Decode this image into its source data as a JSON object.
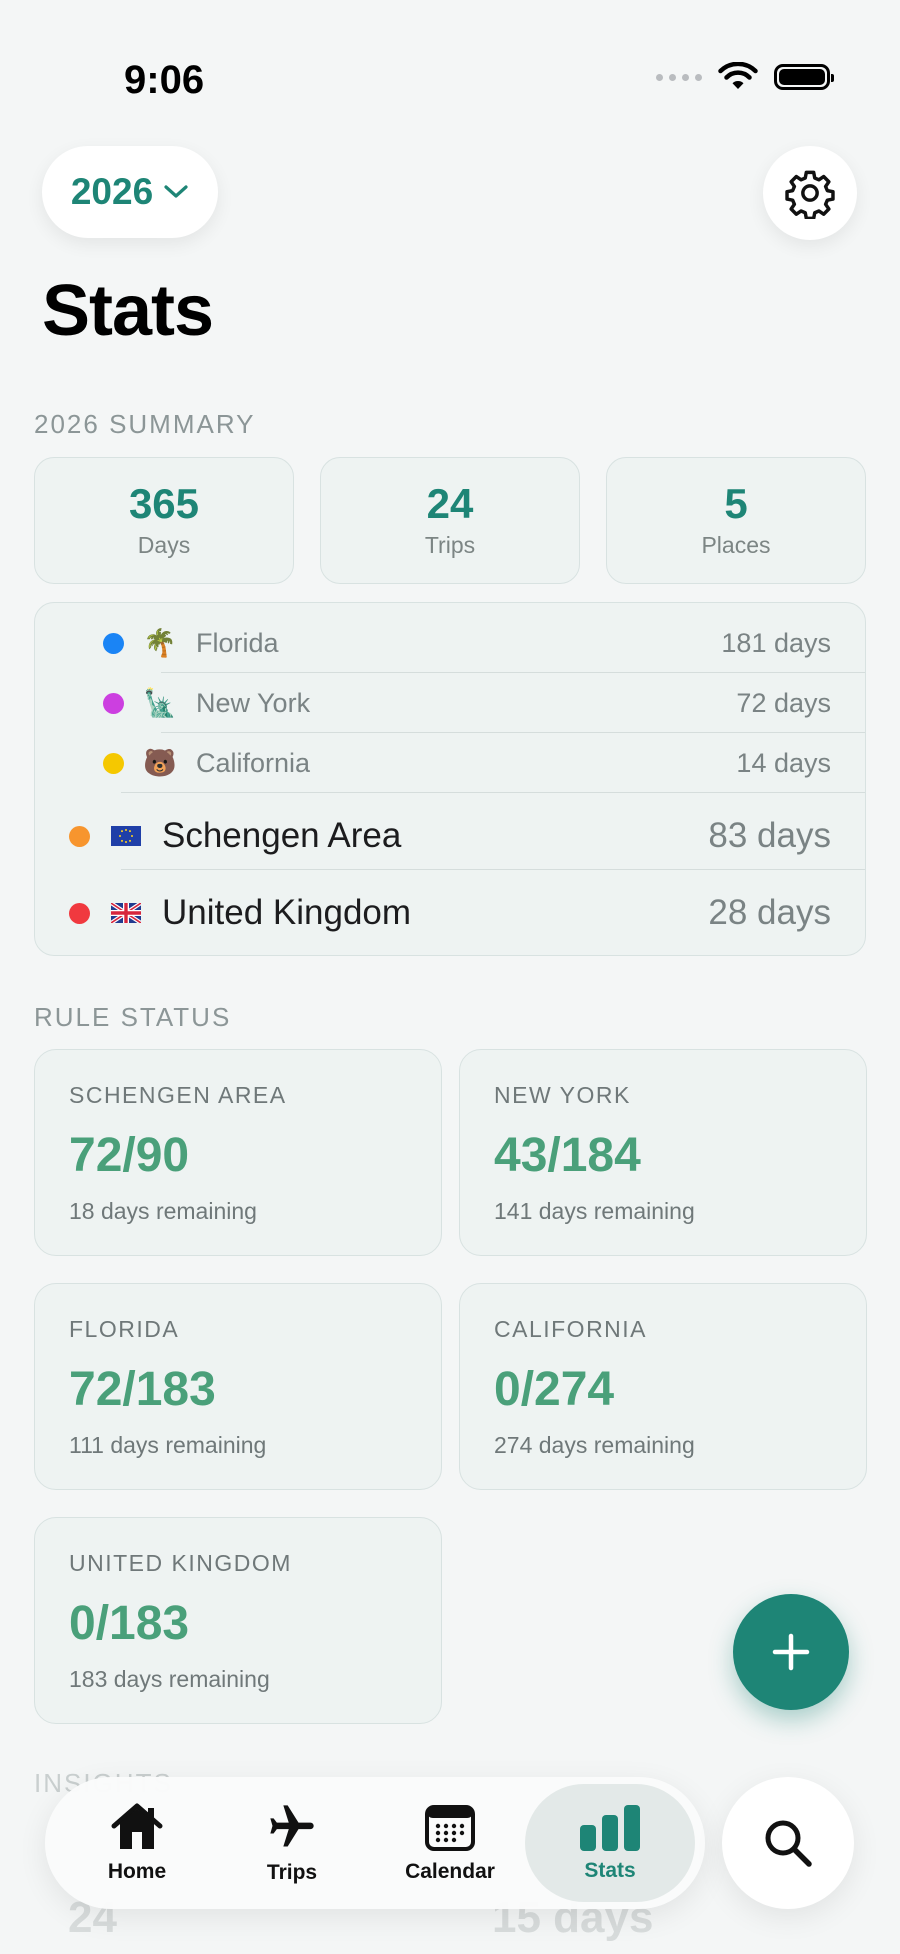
{
  "status_bar": {
    "time": "9:06"
  },
  "header": {
    "year": "2026",
    "title": "Stats"
  },
  "summary": {
    "heading": "2026 SUMMARY",
    "cards": [
      {
        "value": "365",
        "label": "Days"
      },
      {
        "value": "24",
        "label": "Trips"
      },
      {
        "value": "5",
        "label": "Places"
      }
    ]
  },
  "places": [
    {
      "emoji": "🌴",
      "name": "Florida",
      "days": "181 days",
      "color": "#1a84f5"
    },
    {
      "emoji": "🗽",
      "name": "New York",
      "days": "72 days",
      "color": "#cc3fe0"
    },
    {
      "emoji": "🐻",
      "name": "California",
      "days": "14 days",
      "color": "#f5c800"
    },
    {
      "emoji": "eu-flag-icon",
      "name": "Schengen Area",
      "days": "83 days",
      "color": "#f7952e"
    },
    {
      "emoji": "uk-flag-icon",
      "name": "United Kingdom",
      "days": "28 days",
      "color": "#f0393f"
    }
  ],
  "rules": {
    "heading": "RULE STATUS",
    "items": [
      {
        "name": "SCHENGEN AREA",
        "value": "72/90",
        "remaining": "18 days remaining"
      },
      {
        "name": "NEW YORK",
        "value": "43/184",
        "remaining": "141 days remaining"
      },
      {
        "name": "FLORIDA",
        "value": "72/183",
        "remaining": "111 days remaining"
      },
      {
        "name": "CALIFORNIA",
        "value": "0/274",
        "remaining": "274 days remaining"
      },
      {
        "name": "UNITED KINGDOM",
        "value": "0/183",
        "remaining": "183 days remaining"
      }
    ]
  },
  "insights": {
    "heading": "INSIGHTS",
    "value_1": "24",
    "value_2": "15 days"
  },
  "tabs": [
    {
      "label": "Home",
      "icon": "house-icon"
    },
    {
      "label": "Trips",
      "icon": "airplane-icon"
    },
    {
      "label": "Calendar",
      "icon": "calendar-icon"
    },
    {
      "label": "Stats",
      "icon": "bar-chart-icon",
      "active": true
    }
  ],
  "colors": {
    "accent": "#1e8576",
    "rule_value": "#4aa07a",
    "background": "#f4f6f6"
  }
}
